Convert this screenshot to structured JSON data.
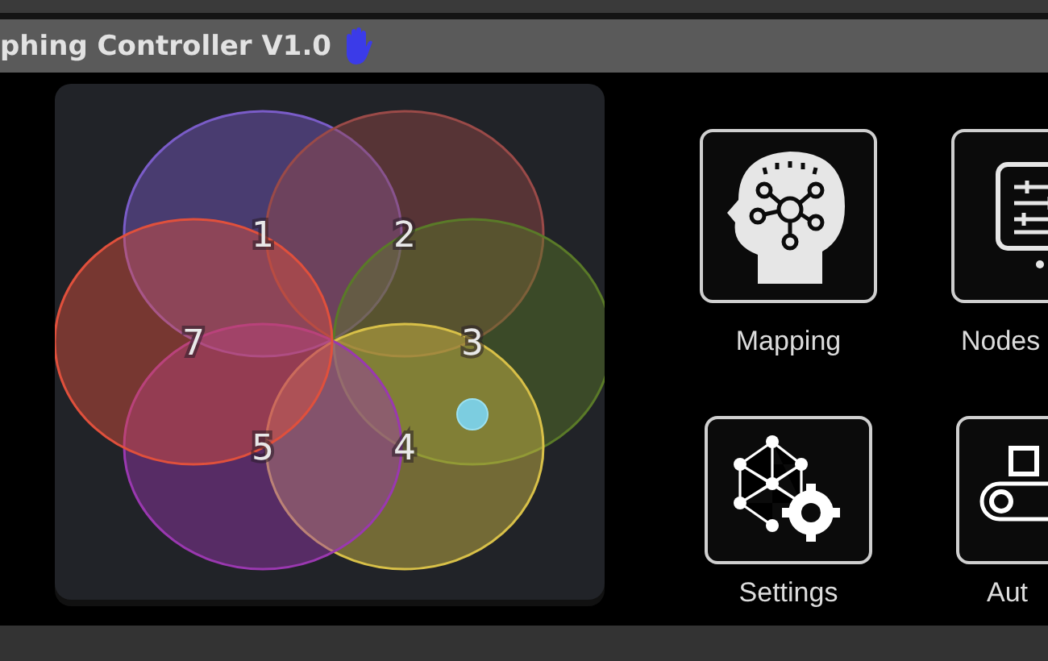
{
  "window": {
    "title": "phing Controller V1.0"
  },
  "zones": [
    {
      "label": "1",
      "color": "#7a5cc8"
    },
    {
      "label": "2",
      "color": "#9a4a48"
    },
    {
      "label": "3",
      "color": "#5a7a28"
    },
    {
      "label": "4",
      "color": "#d8c048"
    },
    {
      "label": "5",
      "color": "#9a38b0"
    },
    {
      "label": "7",
      "color": "#e0503c"
    }
  ],
  "tiles": [
    {
      "label": "Mapping",
      "kind": "mapping"
    },
    {
      "label": "Nodes",
      "kind": "nodes"
    },
    {
      "label": "Settings",
      "kind": "settings"
    },
    {
      "label": "Aut",
      "kind": "automation"
    }
  ]
}
